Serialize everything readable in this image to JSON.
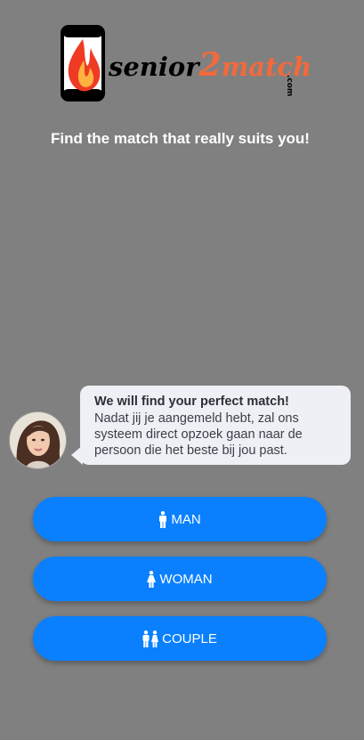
{
  "brand": {
    "part1": "senior",
    "part2": "2",
    "part3": "match",
    "suffix": ".com",
    "accent_color": "#f26a3b"
  },
  "tagline": "Find the match that really suits you!",
  "chat": {
    "title": "We will find your perfect match!",
    "message": "Nadat jij je aangemeld hebt, zal ons systeem direct opzoek gaan naar de persoon die het beste bij jou past."
  },
  "options": [
    {
      "label": "MAN",
      "icon": "male-icon"
    },
    {
      "label": "WOMAN",
      "icon": "female-icon"
    },
    {
      "label": "COUPLE",
      "icon": "couple-icon"
    }
  ],
  "colors": {
    "background": "#808080",
    "button": "#0a80ff",
    "bubble": "#eef0f5"
  }
}
